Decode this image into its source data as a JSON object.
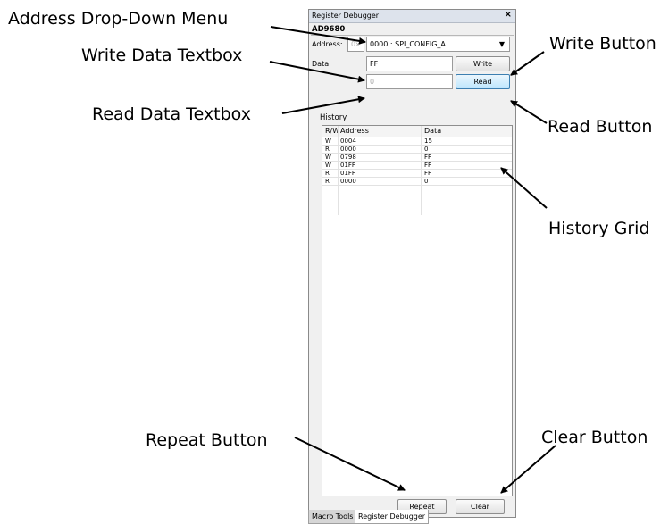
{
  "callouts": {
    "address_dropdown": "Address Drop-Down Menu",
    "write_data_textbox": "Write Data Textbox",
    "read_data_textbox": "Read Data Textbox",
    "write_button": "Write Button",
    "read_button": "Read Button",
    "history_grid": "History Grid",
    "repeat_button": "Repeat Button",
    "clear_button": "Clear Button"
  },
  "panel": {
    "title": "Register Debugger",
    "close_glyph": "×",
    "device": "AD9680",
    "address_label": "Address:",
    "address_prefix": "0x",
    "address_value": "0000 : SPI_CONFIG_A",
    "dropdown_arrow": "▼",
    "data_label": "Data:",
    "write_value": "FF",
    "read_value": "0",
    "write_label": "Write",
    "read_label": "Read",
    "history_label": "History",
    "repeat_label": "Repeat",
    "clear_label": "Clear"
  },
  "history": {
    "columns": [
      "R/W",
      "Address",
      "Data"
    ],
    "rows": [
      [
        "W",
        "0004",
        "15"
      ],
      [
        "R",
        "0000",
        "0"
      ],
      [
        "W",
        "0798",
        "FF"
      ],
      [
        "W",
        "01FF",
        "FF"
      ],
      [
        "R",
        "01FF",
        "FF"
      ],
      [
        "R",
        "0000",
        "0"
      ]
    ]
  },
  "tabs": [
    "Macro Tools",
    "Register Debugger"
  ]
}
